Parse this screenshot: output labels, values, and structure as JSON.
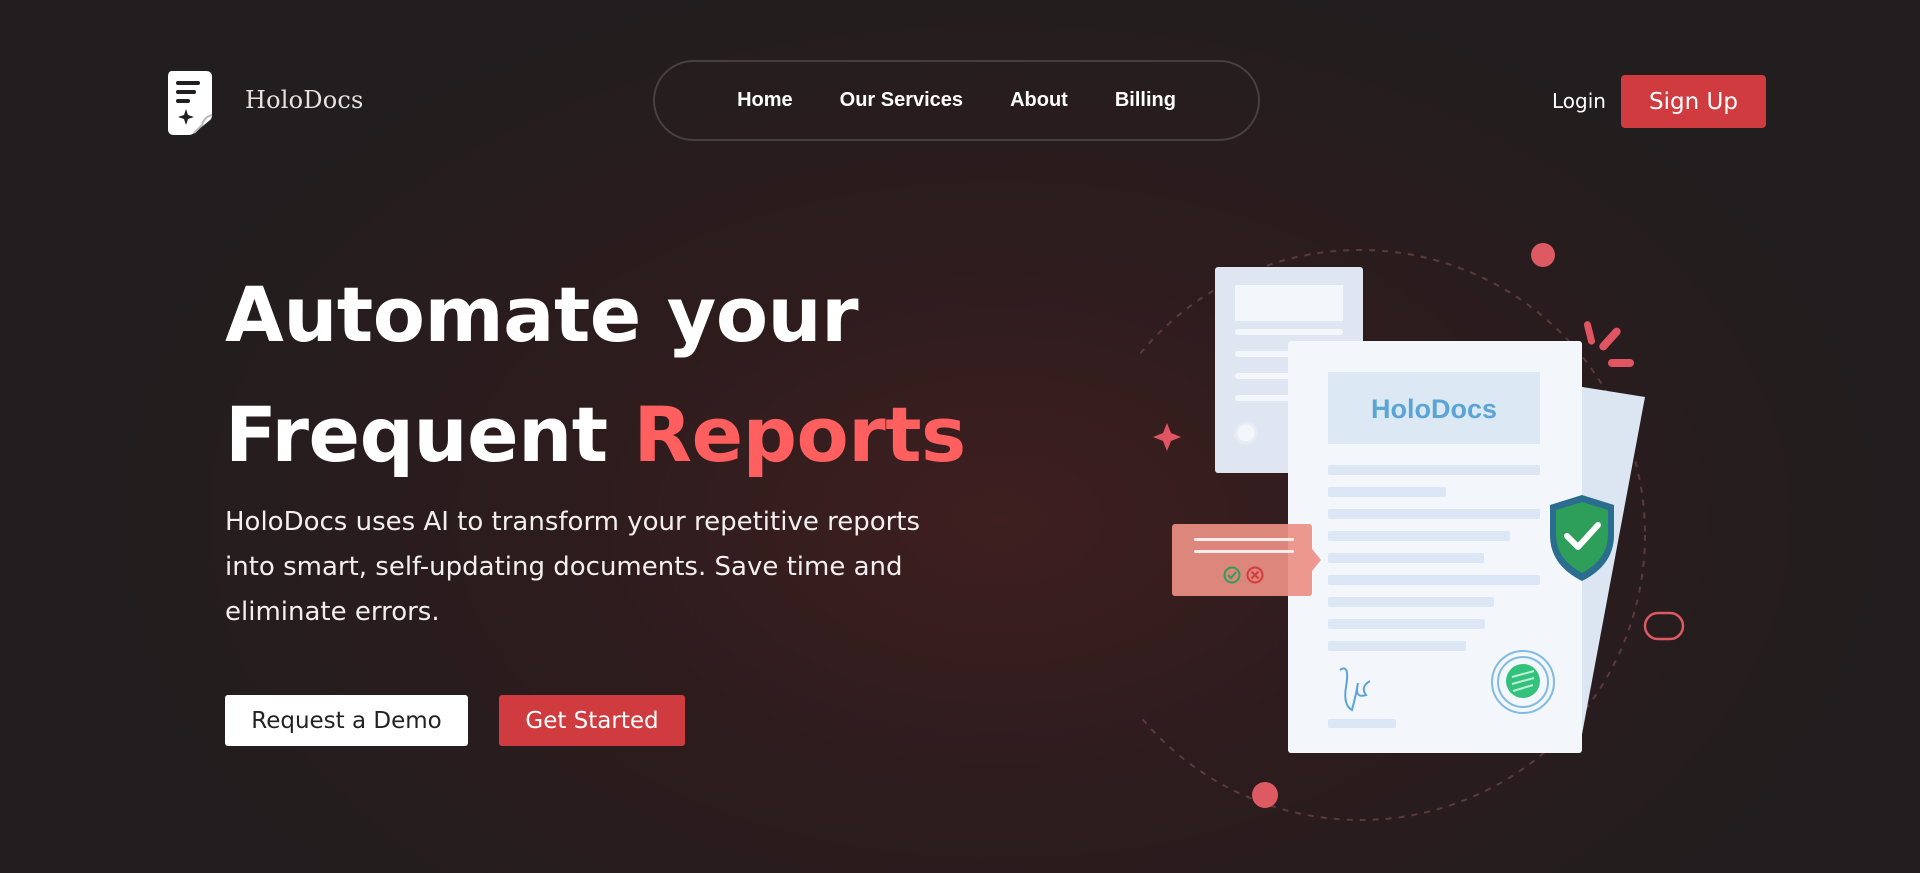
{
  "header": {
    "brand": "HoloDocs",
    "nav": [
      {
        "label": "Home"
      },
      {
        "label": "Our Services"
      },
      {
        "label": "About"
      },
      {
        "label": "Billing"
      }
    ],
    "login_label": "Login",
    "signup_label": "Sign Up"
  },
  "hero": {
    "headline_line1": "Automate your",
    "headline_line2": "Frequent",
    "headline_accent": "Reports",
    "description": "HoloDocs uses AI to transform your repetitive reports into smart, self-updating documents. Save time and eliminate errors.",
    "demo_button": "Request a Demo",
    "start_button": "Get Started"
  },
  "illustration": {
    "doc_brand": "HoloDocs"
  },
  "colors": {
    "accent": "#ff5f5f",
    "primary_button": "#cf3b3f",
    "background": "#221d1e",
    "doc_blue": "#5aa4d6",
    "shield_green": "#2e9e5b"
  },
  "icons": [
    "document-logo-icon",
    "verified-shield-icon",
    "seal-stamp-icon",
    "signature-icon",
    "check-circle-icon",
    "x-circle-icon",
    "sparkle-icon"
  ]
}
